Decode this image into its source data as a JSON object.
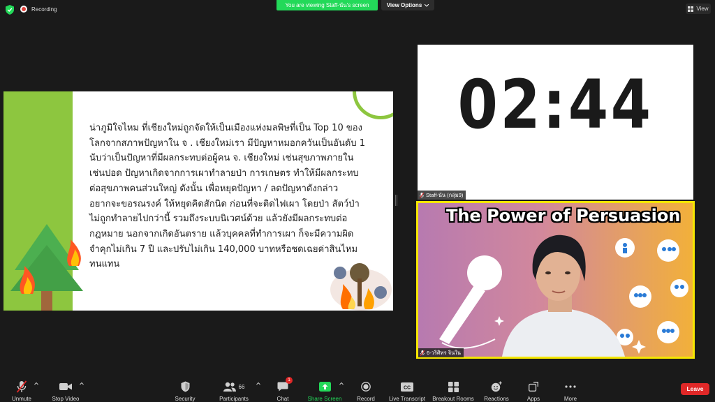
{
  "top": {
    "recording_label": "Recording",
    "viewing_banner": "You are viewing Staff-นัน's screen",
    "view_options_label": "View Options",
    "view_label": "View"
  },
  "slide": {
    "lines": [
      "น่าภูมิใจไหม ที่เชียงใหม่ถูกจัดให้เป็นเมืองแห่งมลพิษที่เป็น Top 10 ของ",
      "โลกจากสภาพปัญหาใน จ . เชียงใหม่เรา มีปัญหาหมอกควันเป็นอันดับ 1",
      "นับว่าเป็นปัญหาที่มีผลกระทบต่อผู้คน จ. เชียงใหม่ เช่นสุขภาพภายใน",
      "เช่นปอด ปัญหาเกิดจากการเผาทำลายป่า การเกษตร ทำให้มีผลกระทบ",
      "ต่อสุขภาพคนส่วนใหญ่ ดังนั้น เพื่อหยุดปัญหา / ลดปัญหาดังกล่าว",
      "อยากจะขอรณรงค์ ให้หยุดคิดสักนิด ก่อนที่จะติดไฟเผา   โดยป่า สัตว์ป่า",
      "ไม่ถูกทำลายไปกว่านี้ รวมถึงระบบนิเวศน์ด้วย  แล้วยังมีผลกระทบต่อ",
      "กฎหมาย นอกจากเกิดอันตราย แล้วบุคคลที่ทำการเผา ก็จะมีความผิด",
      "จำคุกไม่เกิน 7 ปี และปรับไม่เกิน 140,000 บาทหรือชดเฉยค่าสินไหม",
      "ทนแทน"
    ]
  },
  "timer": {
    "value": "02:44",
    "participant_name": "Staff-นัน (กลุ่ม9)"
  },
  "speaker": {
    "slide_title": "The Power of Persuasion",
    "participant_name": "6-วริศิทร จินใน"
  },
  "toolbar": {
    "unmute": "Unmute",
    "stop_video": "Stop Video",
    "security": "Security",
    "participants": "Participants",
    "participants_count": "66",
    "chat": "Chat",
    "chat_badge": "1",
    "share_screen": "Share Screen",
    "record": "Record",
    "live_transcript": "Live Transcript",
    "breakout_rooms": "Breakout Rooms",
    "reactions": "Reactions",
    "apps": "Apps",
    "more": "More",
    "leave": "Leave",
    "cc_glyph": "CC"
  },
  "colors": {
    "accent_green": "#23d959",
    "slide_green": "#8dc63f",
    "leave_red": "#e02828",
    "speaker_border": "#f5e600"
  }
}
